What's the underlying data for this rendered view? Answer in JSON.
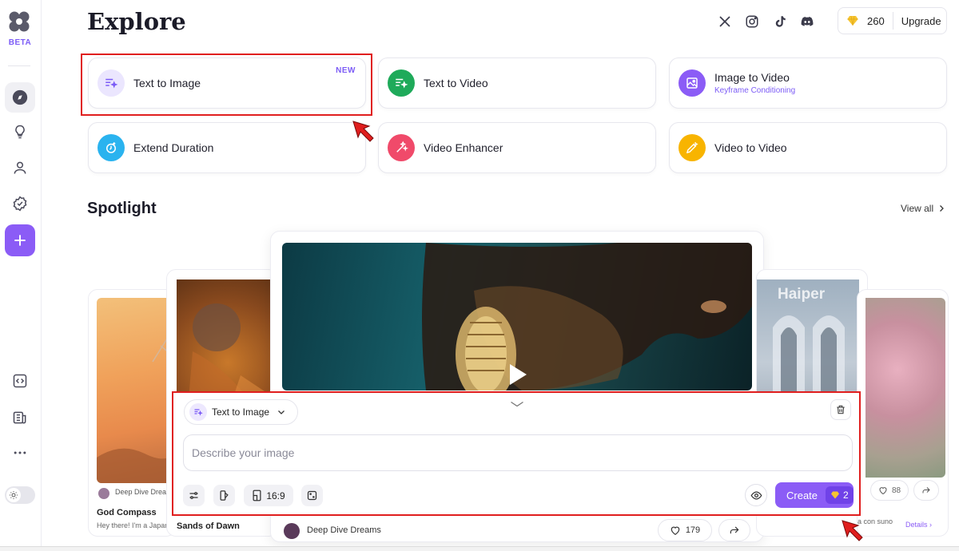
{
  "sidebar": {
    "beta_label": "BETA",
    "items": [
      "compass-icon",
      "lightbulb-icon",
      "user-icon",
      "badge-check-icon",
      "plus-icon",
      "code-icon",
      "news-icon",
      "more-icon"
    ]
  },
  "header": {
    "title": "Explore",
    "credits": "260",
    "upgrade_label": "Upgrade",
    "social": [
      "x-icon",
      "instagram-icon",
      "tiktok-icon",
      "discord-icon"
    ]
  },
  "tools": {
    "text_to_image": {
      "label": "Text to Image",
      "badge": "NEW"
    },
    "text_to_video": {
      "label": "Text to Video"
    },
    "image_to_video": {
      "label": "Image to Video",
      "sub": "Keyframe Conditioning"
    },
    "extend_duration": {
      "label": "Extend Duration"
    },
    "video_enhancer": {
      "label": "Video Enhancer"
    },
    "video_to_video": {
      "label": "Video to Video"
    }
  },
  "spotlight": {
    "title": "Spotlight",
    "view_all": "View all",
    "cards": {
      "left1": {
        "author": "Deep Dive Dream",
        "title": "God Compass",
        "desc": "Hey there! I'm a Japane"
      },
      "left2": {
        "title": "Sands of Dawn"
      },
      "center": {
        "author": "Deep Dive Dreams",
        "likes": "179"
      },
      "right2": {
        "watermark": "Haiper"
      },
      "right1": {
        "likes": "88",
        "desc": "a con suno",
        "details": "Details"
      }
    }
  },
  "prompt": {
    "mode_label": "Text to Image",
    "placeholder": "Describe your image",
    "aspect": "16:9",
    "create_label": "Create",
    "cost": "2"
  },
  "colors": {
    "accent": "#8b5cf6",
    "highlight": "#e01e1e"
  }
}
